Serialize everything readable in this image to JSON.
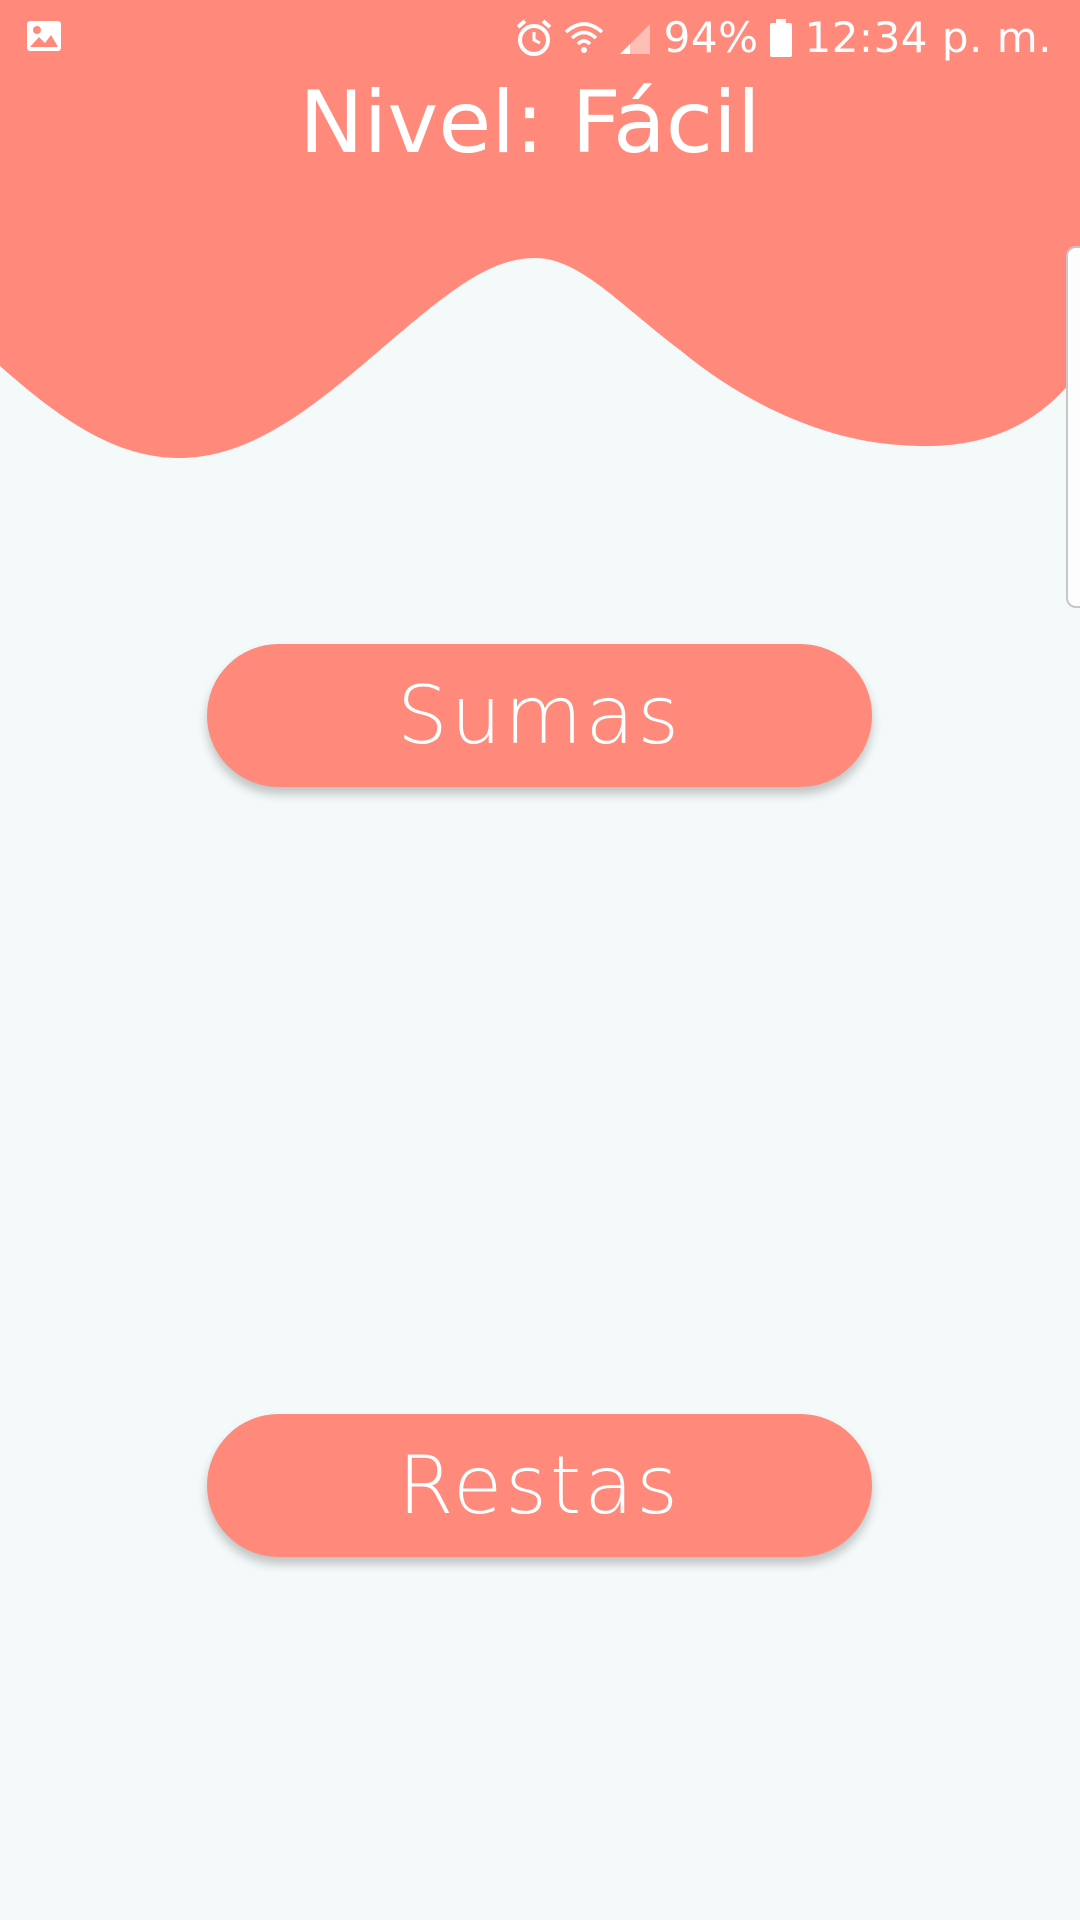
{
  "status_bar": {
    "notification_icon": "image-icon",
    "alarm_icon": "alarm-icon",
    "wifi_icon": "wifi-icon",
    "signal_icon": "signal-icon",
    "battery_percent": "94%",
    "battery_icon": "battery-icon",
    "time": "12:34 p. m."
  },
  "header": {
    "title": "Nivel: Fácil"
  },
  "menu": {
    "sumas_label": "Sumas",
    "restas_label": "Restas"
  },
  "colors": {
    "accent": "#ff8a7c",
    "background": "#f4f9fa",
    "text_on_accent": "#ffffff"
  }
}
